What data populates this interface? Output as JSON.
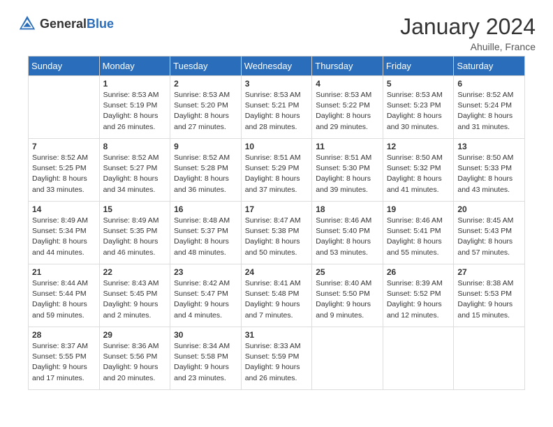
{
  "header": {
    "logo_general": "General",
    "logo_blue": "Blue",
    "month_year": "January 2024",
    "location": "Ahuille, France"
  },
  "days_of_week": [
    "Sunday",
    "Monday",
    "Tuesday",
    "Wednesday",
    "Thursday",
    "Friday",
    "Saturday"
  ],
  "weeks": [
    [
      {
        "day": "",
        "sunrise": "",
        "sunset": "",
        "daylight": ""
      },
      {
        "day": "1",
        "sunrise": "Sunrise: 8:53 AM",
        "sunset": "Sunset: 5:19 PM",
        "daylight": "Daylight: 8 hours and 26 minutes."
      },
      {
        "day": "2",
        "sunrise": "Sunrise: 8:53 AM",
        "sunset": "Sunset: 5:20 PM",
        "daylight": "Daylight: 8 hours and 27 minutes."
      },
      {
        "day": "3",
        "sunrise": "Sunrise: 8:53 AM",
        "sunset": "Sunset: 5:21 PM",
        "daylight": "Daylight: 8 hours and 28 minutes."
      },
      {
        "day": "4",
        "sunrise": "Sunrise: 8:53 AM",
        "sunset": "Sunset: 5:22 PM",
        "daylight": "Daylight: 8 hours and 29 minutes."
      },
      {
        "day": "5",
        "sunrise": "Sunrise: 8:53 AM",
        "sunset": "Sunset: 5:23 PM",
        "daylight": "Daylight: 8 hours and 30 minutes."
      },
      {
        "day": "6",
        "sunrise": "Sunrise: 8:52 AM",
        "sunset": "Sunset: 5:24 PM",
        "daylight": "Daylight: 8 hours and 31 minutes."
      }
    ],
    [
      {
        "day": "7",
        "sunrise": "Sunrise: 8:52 AM",
        "sunset": "Sunset: 5:25 PM",
        "daylight": "Daylight: 8 hours and 33 minutes."
      },
      {
        "day": "8",
        "sunrise": "Sunrise: 8:52 AM",
        "sunset": "Sunset: 5:27 PM",
        "daylight": "Daylight: 8 hours and 34 minutes."
      },
      {
        "day": "9",
        "sunrise": "Sunrise: 8:52 AM",
        "sunset": "Sunset: 5:28 PM",
        "daylight": "Daylight: 8 hours and 36 minutes."
      },
      {
        "day": "10",
        "sunrise": "Sunrise: 8:51 AM",
        "sunset": "Sunset: 5:29 PM",
        "daylight": "Daylight: 8 hours and 37 minutes."
      },
      {
        "day": "11",
        "sunrise": "Sunrise: 8:51 AM",
        "sunset": "Sunset: 5:30 PM",
        "daylight": "Daylight: 8 hours and 39 minutes."
      },
      {
        "day": "12",
        "sunrise": "Sunrise: 8:50 AM",
        "sunset": "Sunset: 5:32 PM",
        "daylight": "Daylight: 8 hours and 41 minutes."
      },
      {
        "day": "13",
        "sunrise": "Sunrise: 8:50 AM",
        "sunset": "Sunset: 5:33 PM",
        "daylight": "Daylight: 8 hours and 43 minutes."
      }
    ],
    [
      {
        "day": "14",
        "sunrise": "Sunrise: 8:49 AM",
        "sunset": "Sunset: 5:34 PM",
        "daylight": "Daylight: 8 hours and 44 minutes."
      },
      {
        "day": "15",
        "sunrise": "Sunrise: 8:49 AM",
        "sunset": "Sunset: 5:35 PM",
        "daylight": "Daylight: 8 hours and 46 minutes."
      },
      {
        "day": "16",
        "sunrise": "Sunrise: 8:48 AM",
        "sunset": "Sunset: 5:37 PM",
        "daylight": "Daylight: 8 hours and 48 minutes."
      },
      {
        "day": "17",
        "sunrise": "Sunrise: 8:47 AM",
        "sunset": "Sunset: 5:38 PM",
        "daylight": "Daylight: 8 hours and 50 minutes."
      },
      {
        "day": "18",
        "sunrise": "Sunrise: 8:46 AM",
        "sunset": "Sunset: 5:40 PM",
        "daylight": "Daylight: 8 hours and 53 minutes."
      },
      {
        "day": "19",
        "sunrise": "Sunrise: 8:46 AM",
        "sunset": "Sunset: 5:41 PM",
        "daylight": "Daylight: 8 hours and 55 minutes."
      },
      {
        "day": "20",
        "sunrise": "Sunrise: 8:45 AM",
        "sunset": "Sunset: 5:43 PM",
        "daylight": "Daylight: 8 hours and 57 minutes."
      }
    ],
    [
      {
        "day": "21",
        "sunrise": "Sunrise: 8:44 AM",
        "sunset": "Sunset: 5:44 PM",
        "daylight": "Daylight: 8 hours and 59 minutes."
      },
      {
        "day": "22",
        "sunrise": "Sunrise: 8:43 AM",
        "sunset": "Sunset: 5:45 PM",
        "daylight": "Daylight: 9 hours and 2 minutes."
      },
      {
        "day": "23",
        "sunrise": "Sunrise: 8:42 AM",
        "sunset": "Sunset: 5:47 PM",
        "daylight": "Daylight: 9 hours and 4 minutes."
      },
      {
        "day": "24",
        "sunrise": "Sunrise: 8:41 AM",
        "sunset": "Sunset: 5:48 PM",
        "daylight": "Daylight: 9 hours and 7 minutes."
      },
      {
        "day": "25",
        "sunrise": "Sunrise: 8:40 AM",
        "sunset": "Sunset: 5:50 PM",
        "daylight": "Daylight: 9 hours and 9 minutes."
      },
      {
        "day": "26",
        "sunrise": "Sunrise: 8:39 AM",
        "sunset": "Sunset: 5:52 PM",
        "daylight": "Daylight: 9 hours and 12 minutes."
      },
      {
        "day": "27",
        "sunrise": "Sunrise: 8:38 AM",
        "sunset": "Sunset: 5:53 PM",
        "daylight": "Daylight: 9 hours and 15 minutes."
      }
    ],
    [
      {
        "day": "28",
        "sunrise": "Sunrise: 8:37 AM",
        "sunset": "Sunset: 5:55 PM",
        "daylight": "Daylight: 9 hours and 17 minutes."
      },
      {
        "day": "29",
        "sunrise": "Sunrise: 8:36 AM",
        "sunset": "Sunset: 5:56 PM",
        "daylight": "Daylight: 9 hours and 20 minutes."
      },
      {
        "day": "30",
        "sunrise": "Sunrise: 8:34 AM",
        "sunset": "Sunset: 5:58 PM",
        "daylight": "Daylight: 9 hours and 23 minutes."
      },
      {
        "day": "31",
        "sunrise": "Sunrise: 8:33 AM",
        "sunset": "Sunset: 5:59 PM",
        "daylight": "Daylight: 9 hours and 26 minutes."
      },
      {
        "day": "",
        "sunrise": "",
        "sunset": "",
        "daylight": ""
      },
      {
        "day": "",
        "sunrise": "",
        "sunset": "",
        "daylight": ""
      },
      {
        "day": "",
        "sunrise": "",
        "sunset": "",
        "daylight": ""
      }
    ]
  ]
}
